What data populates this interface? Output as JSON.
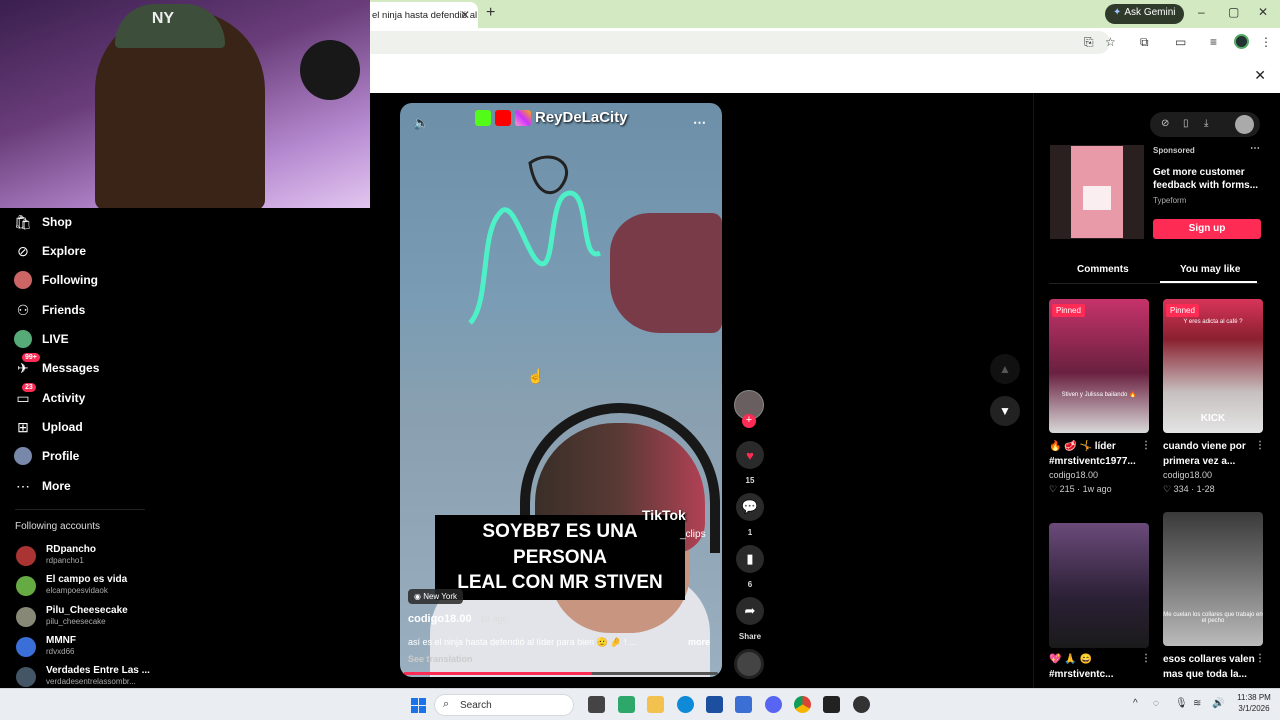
{
  "browser": {
    "tab_title": "el ninja hasta defendió al",
    "new_tab": "+",
    "gemini_label": "Ask Gemini",
    "minimize": "–",
    "maximize": "▢",
    "close": "✕"
  },
  "page": {
    "close_label": "✕"
  },
  "nav": {
    "items": [
      {
        "label": "Shop",
        "icon": "shop-icon"
      },
      {
        "label": "Explore",
        "icon": "explore-icon"
      },
      {
        "label": "Following",
        "icon": "following-avatar"
      },
      {
        "label": "Friends",
        "icon": "friends-icon"
      },
      {
        "label": "LIVE",
        "icon": "live-icon"
      },
      {
        "label": "Messages",
        "icon": "messages-icon",
        "badge": "99+"
      },
      {
        "label": "Activity",
        "icon": "activity-icon",
        "badge": "23"
      },
      {
        "label": "Upload",
        "icon": "upload-icon"
      },
      {
        "label": "Profile",
        "icon": "profile-avatar"
      },
      {
        "label": "More",
        "icon": "more-icon"
      }
    ],
    "following_title": "Following accounts",
    "accounts": [
      {
        "name": "RDpancho",
        "handle": "rdpancho1"
      },
      {
        "name": "El campo es vida",
        "handle": "elcampoesvidaok"
      },
      {
        "name": "Pilu_Cheesecake",
        "handle": "pilu_cheesecake"
      },
      {
        "name": "MMNF",
        "handle": "rdvxd66"
      },
      {
        "name": "Verdades Entre Las ...",
        "handle": "verdadesentrelassombr..."
      }
    ]
  },
  "video": {
    "brand_text": "ReyDeLaCity",
    "caption_line1": "SOYBB7 ES UNA PERSONA",
    "caption_line2": "LEAL CON MR STIVEN",
    "watermark": "TikTok",
    "watermark_handle": "_clips",
    "location": "New York",
    "creator": "codigo18.00",
    "time_ago": "· 1d ago",
    "description": "así es el ninja  hasta defendió al líder para bien 🫡 🤌 ! ...",
    "more": "more",
    "translate": "See translation",
    "progress": 0.6
  },
  "actions": {
    "like_count": "15",
    "comment_count": "1",
    "save_count": "6",
    "share_label": "Share"
  },
  "right_panel": {
    "ad": {
      "sponsored": "Sponsored",
      "title": "Get more customer feedback with forms...",
      "brand": "Typeform",
      "cta": "Sign up"
    },
    "tabs": [
      "Comments",
      "You may like"
    ],
    "cards": [
      {
        "pinned": "Pinned",
        "title": "🔥 🥩 🤸 líder #mrstiventc1977...",
        "author": "codigo18.00",
        "meta": "♡ 215 · 1w ago",
        "thumb_text": "Stiven y Julissa bailando 🔥"
      },
      {
        "pinned": "Pinned",
        "title": "cuando viene por primera vez a...",
        "author": "codigo18.00",
        "meta": "♡ 334 · 1-28",
        "thumb_text": "Y eres adicta al café ?"
      },
      {
        "pinned": "",
        "title": "💖 🙏 😄 #mrstiventc...",
        "author": "",
        "meta": "",
        "thumb_text": ""
      },
      {
        "pinned": "",
        "title": "esos collares valen mas que toda la...",
        "author": "",
        "meta": "",
        "thumb_text": "Me cuelan los collares que trabajo en el pecho"
      }
    ]
  },
  "taskbar": {
    "search": "Search",
    "time": "11:38 PM",
    "date": "3/1/2026"
  }
}
